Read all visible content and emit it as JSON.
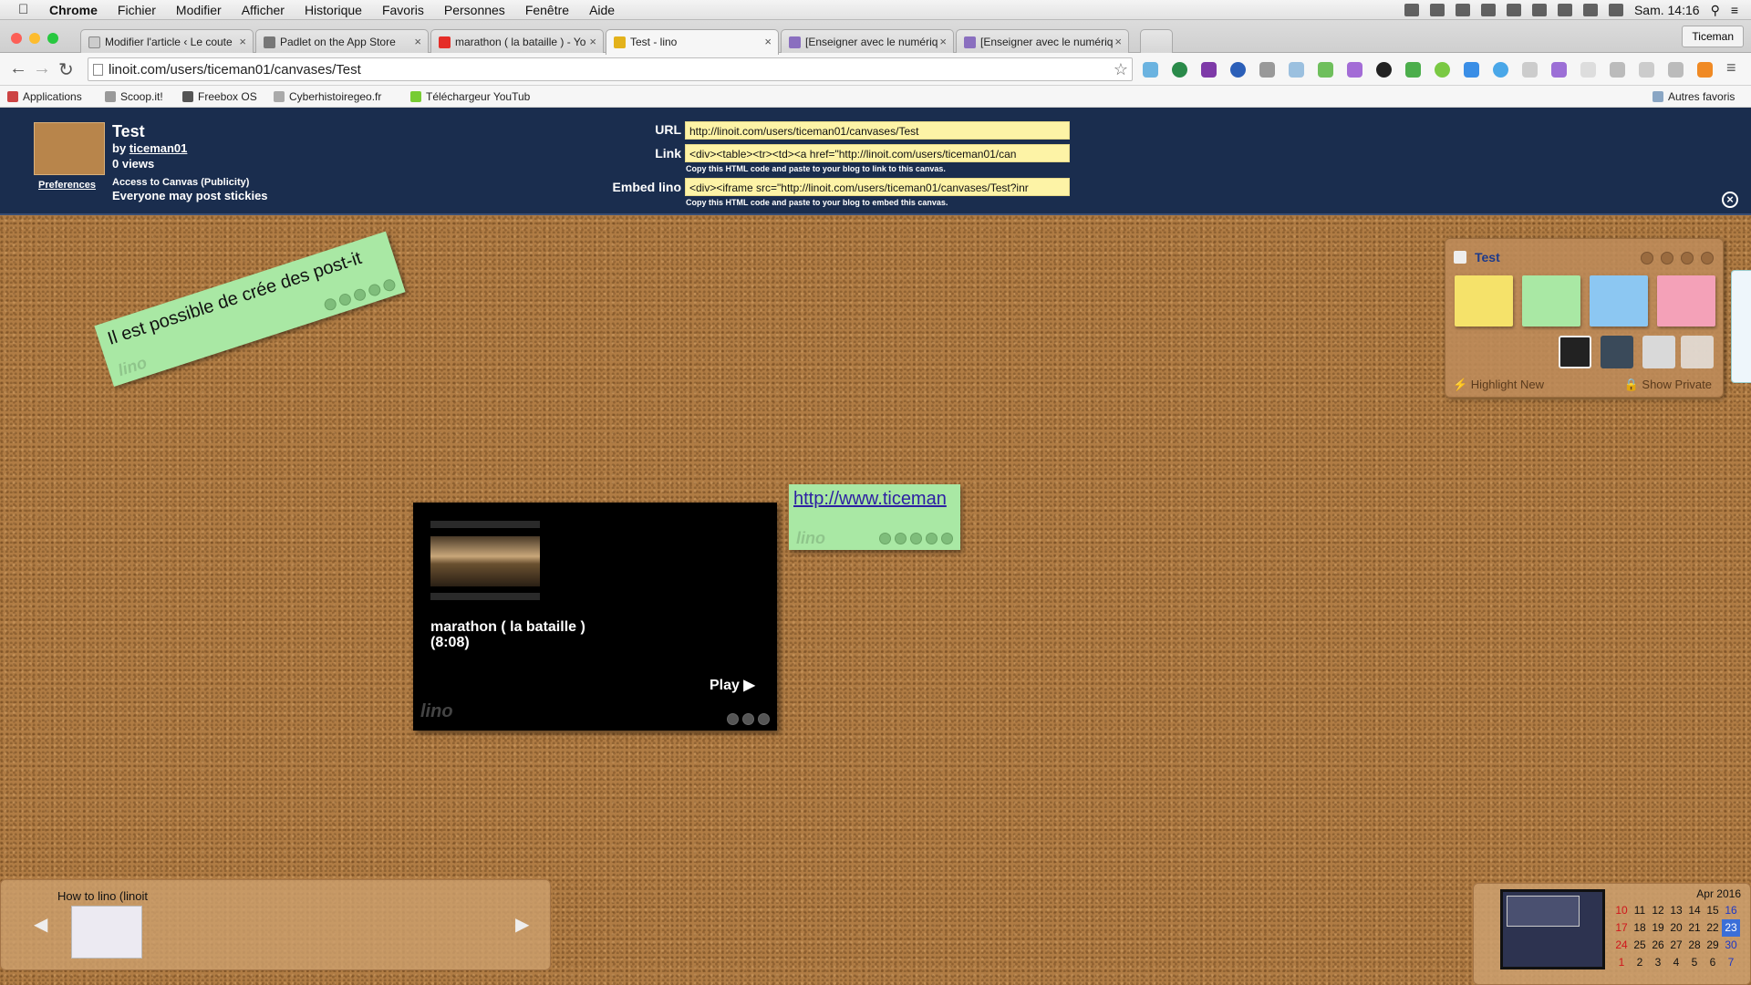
{
  "menubar": {
    "apple": "",
    "app": "Chrome",
    "items": [
      "Fichier",
      "Modifier",
      "Afficher",
      "Historique",
      "Favoris",
      "Personnes",
      "Fenêtre",
      "Aide"
    ],
    "clock": "Sam. 14:16"
  },
  "tabs": [
    {
      "title": "Modifier l'article ‹ Le coute",
      "color": "#888"
    },
    {
      "title": "Padlet on the App Store",
      "color": "#777"
    },
    {
      "title": "marathon ( la bataille ) - Yo",
      "color": "#e52d27"
    },
    {
      "title": "Test - lino",
      "color": "#e3b21b"
    },
    {
      "title": "[Enseigner avec le numériq",
      "color": "#8a6fbf"
    },
    {
      "title": "[Enseigner avec le numériq",
      "color": "#8a6fbf"
    }
  ],
  "profile": "Ticeman",
  "omnibox": {
    "url": "linoit.com/users/ticeman01/canvases/Test"
  },
  "bookmarks": [
    {
      "label": "Applications",
      "color": "#c44"
    },
    {
      "label": "Scoop.it!",
      "color": "#999"
    },
    {
      "label": "Freebox OS",
      "color": "#555"
    },
    {
      "label": "Cyberhistoiregeo.fr",
      "color": "#aaa"
    },
    {
      "label": "Téléchargeur YouTub",
      "color": "#7c3"
    }
  ],
  "other_bookmarks": "Autres favoris",
  "canvas": {
    "title": "Test",
    "by": "by ",
    "owner": "ticeman01",
    "views": "0 views",
    "preferences": "Preferences",
    "access": "Access to Canvas (Publicity)",
    "posting": "Everyone may post stickies",
    "url_label": "URL",
    "url_value": "http://linoit.com/users/ticeman01/canvases/Test",
    "link_label": "Link",
    "link_value": "<div><table><tr><td><a href=\"http://linoit.com/users/ticeman01/can",
    "link_hint": "Copy this HTML code and paste to your blog to link to this canvas.",
    "embed_label": "Embed lino",
    "embed_value": "<div><iframe src=\"http://linoit.com/users/ticeman01/canvases/Test?inr",
    "embed_hint": "Copy this HTML code and paste to your blog to embed this canvas."
  },
  "stickies": {
    "note1": "Il est possible de crée des post-it",
    "note2_link": "http://www.ticeman",
    "video_title": "marathon ( la bataille )",
    "video_duration": "(8:08)",
    "play": "Play ▶",
    "watermark": "lino"
  },
  "palette": {
    "title": "Test",
    "highlight": "⚡ Highlight New",
    "show_private": "🔒 Show Private",
    "note_colors": [
      "#f5e26a",
      "#a9e8a4",
      "#8cc7f2",
      "#f4a1b8"
    ]
  },
  "howto": {
    "title": "How to lino (linoit"
  },
  "calendar": {
    "month": "Apr 2016",
    "rows": [
      [
        "10",
        "11",
        "12",
        "13",
        "14",
        "15",
        "16"
      ],
      [
        "17",
        "18",
        "19",
        "20",
        "21",
        "22",
        "23"
      ],
      [
        "24",
        "25",
        "26",
        "27",
        "28",
        "29",
        "30"
      ],
      [
        "1",
        "2",
        "3",
        "4",
        "5",
        "6",
        "7"
      ]
    ]
  }
}
